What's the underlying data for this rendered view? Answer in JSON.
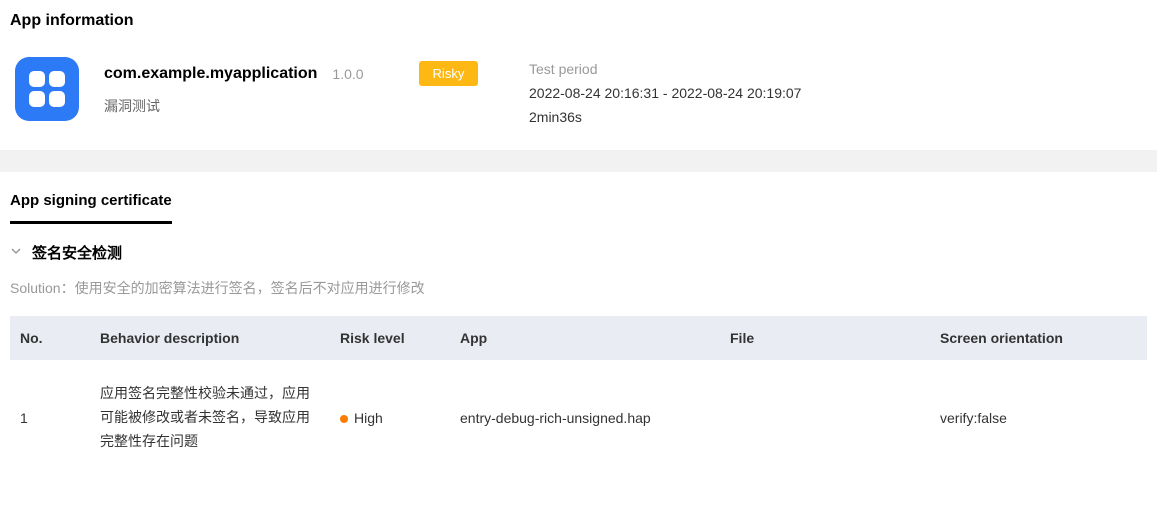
{
  "sections": {
    "app_info_title": "App information",
    "signing_tab": "App signing certificate"
  },
  "app": {
    "name": "com.example.myapplication",
    "version": "1.0.0",
    "risk_badge": "Risky",
    "subtitle": "漏洞测试"
  },
  "test_period": {
    "label": "Test period",
    "range": "2022-08-24 20:16:31 - 2022-08-24 20:19:07",
    "duration": "2min36s"
  },
  "signing": {
    "collapse_title": "签名安全检测",
    "solution_label": "Solution：",
    "solution_text": "使用安全的加密算法进行签名，签名后不对应用进行修改"
  },
  "table": {
    "headers": {
      "no": "No.",
      "behavior": "Behavior description",
      "risk": "Risk level",
      "app": "App",
      "file": "File",
      "screen": "Screen orientation"
    },
    "rows": [
      {
        "no": "1",
        "behavior": "应用签名完整性校验未通过，应用可能被修改或者未签名，导致应用完整性存在问题",
        "risk": "High",
        "app": "entry-debug-rich-unsigned.hap",
        "file": "",
        "screen": "verify:false"
      }
    ]
  }
}
